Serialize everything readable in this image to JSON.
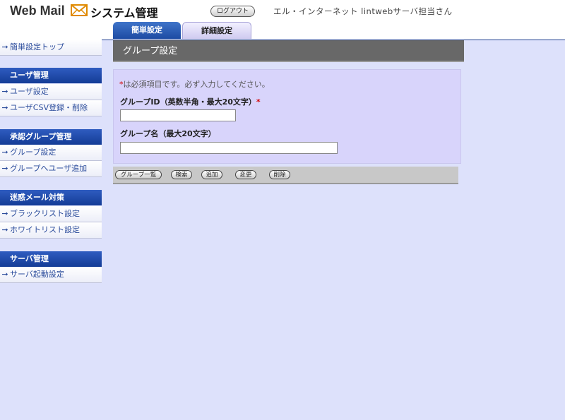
{
  "header": {
    "logo_text": "Web Mail",
    "app_title": "システム管理",
    "logout_label": "ログアウト",
    "user_name": "エル・インターネット lintwebサーバ担当さん"
  },
  "tabs": [
    {
      "label": "簡単設定"
    },
    {
      "label": "詳細設定"
    }
  ],
  "sidebar": {
    "top_link": "簡単設定トップ",
    "sections": [
      {
        "heading": "ユーザ管理",
        "items": [
          "ユーザ設定",
          "ユーザCSV登録・削除"
        ]
      },
      {
        "heading": "承認グループ管理",
        "items": [
          "グループ設定",
          "グループへユーザ追加"
        ]
      },
      {
        "heading": "迷惑メール対策",
        "items": [
          "ブラックリスト設定",
          "ホワイトリスト設定"
        ]
      },
      {
        "heading": "サーバ管理",
        "items": [
          "サーバ起動設定"
        ]
      }
    ]
  },
  "main": {
    "title": "グループ設定",
    "required_marker": "*",
    "required_note": "は必須項目です。必ず入力してください。",
    "group_id_label": "グループID（英数半角・最大20文字）",
    "group_id_value": "",
    "group_name_label": "グループ名（最大20文字）",
    "group_name_value": ""
  },
  "buttons": {
    "list": "グループ一覧",
    "search": "検索",
    "add": "追加",
    "modify": "変更",
    "delete": "削除"
  },
  "colors": {
    "background": "#dde1fb",
    "accent_blue": "#1d4ba3",
    "required_red": "#d40000"
  }
}
